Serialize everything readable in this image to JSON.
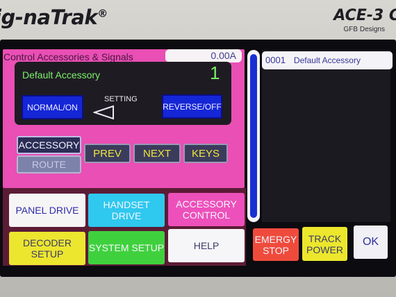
{
  "device": {
    "brand": "ig-naTrak",
    "brand_mark": "®",
    "model": "ACE-3 C",
    "maker": "GFB Designs"
  },
  "control_panel": {
    "title": "Control Accessories & Signals",
    "current": "0.00A",
    "accessory_name": "Default Accessory",
    "accessory_number": "1",
    "setting_label": "SETTING",
    "normal_label": "NORMAL/ON",
    "reverse_label": "REVERSE/OFF",
    "accessory_tab": "ACCESSORY",
    "route_tab": "ROUTE",
    "prev_label": "PREV",
    "next_label": "NEXT",
    "keys_label": "KEYS"
  },
  "modes": {
    "panel_drive": "PANEL DRIVE",
    "handset_drive": "HANDSET DRIVE",
    "accessory_control": "ACCESSORY CONTROL",
    "decoder_setup": "DECODER SETUP",
    "system_setup": "SYSTEM SETUP",
    "help": "HELP"
  },
  "accessory_list": {
    "items": [
      {
        "number": "0001",
        "name": "Default Accessory"
      }
    ]
  },
  "actions": {
    "emergency_stop": "EMERGY STOP",
    "track_power": "TRACK POWER",
    "ok": "OK"
  },
  "colors": {
    "panel_pink": "#e94fb4",
    "led_green": "#7cf06a",
    "button_blue": "#1526d6",
    "key_yellow": "#ede63c"
  }
}
